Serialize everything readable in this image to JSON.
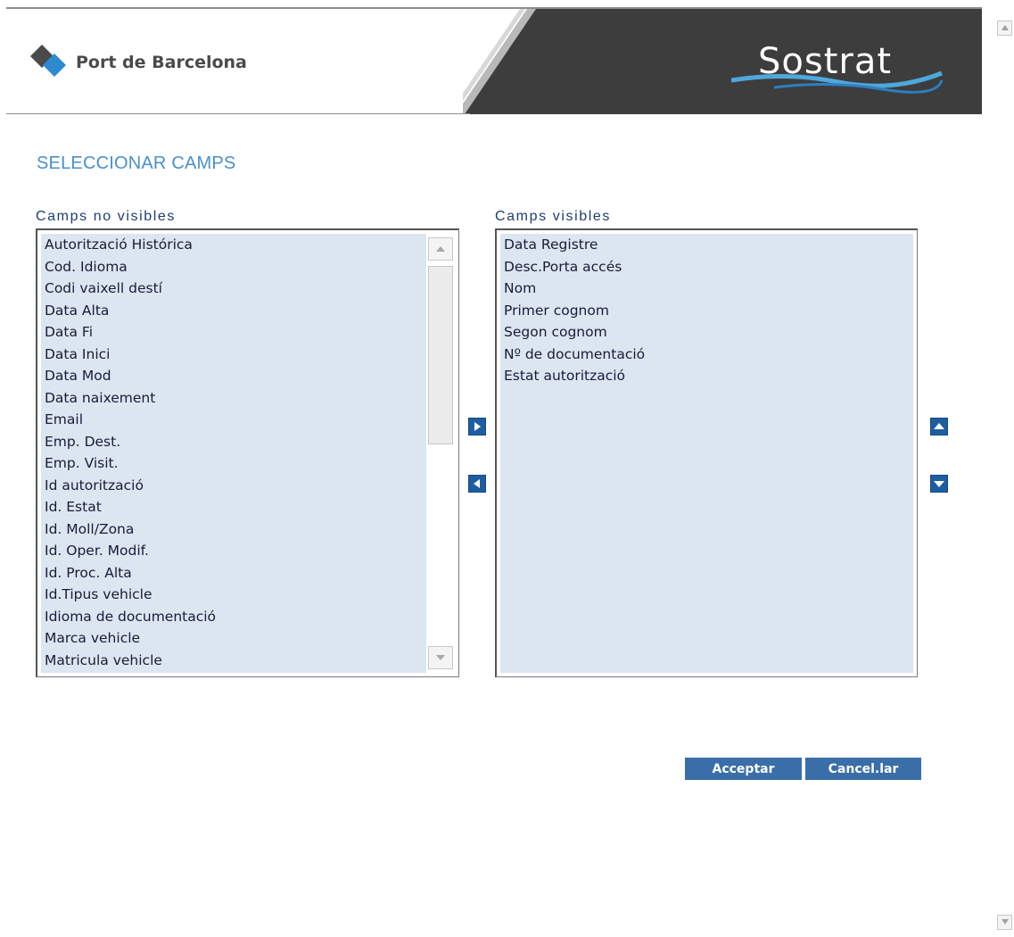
{
  "header": {
    "brand_name": "Port de Barcelona",
    "product_logo_text": "Sostrat",
    "colors": {
      "band": "#3d3d3d",
      "accent": "#4a90c8",
      "wave": "#4ea8dc"
    }
  },
  "page": {
    "title": "SELECCIONAR CAMPS"
  },
  "hidden_fields": {
    "label": "Camps no visibles",
    "items": [
      "Autorització Histórica",
      "Cod. Idioma",
      "Codi vaixell destí",
      "Data Alta",
      "Data Fi",
      "Data Inici",
      "Data Mod",
      "Data naixement",
      "Email",
      "Emp. Dest.",
      "Emp. Visit.",
      "Id autorització",
      "Id. Estat",
      "Id. Moll/Zona",
      "Id. Oper. Modif.",
      "Id. Proc. Alta",
      "Id.Tipus vehicle",
      "Idioma de documentació",
      "Marca vehicle",
      "Matricula vehicle"
    ]
  },
  "visible_fields": {
    "label": "Camps visibles",
    "items": [
      "Data Registre",
      "Desc.Porta accés",
      "Nom",
      "Primer cognom",
      "Segon cognom",
      "Nº de documentació",
      "Estat autorització"
    ]
  },
  "icons": {
    "move_right": "triangle-right-icon",
    "move_left": "triangle-left-icon",
    "move_up": "triangle-up-icon",
    "move_down": "triangle-down-icon",
    "brand": "diamond-logo-icon"
  },
  "actions": {
    "accept_label": "Acceptar",
    "cancel_label": "Cancel.lar",
    "button_color": "#3a6ea8"
  }
}
